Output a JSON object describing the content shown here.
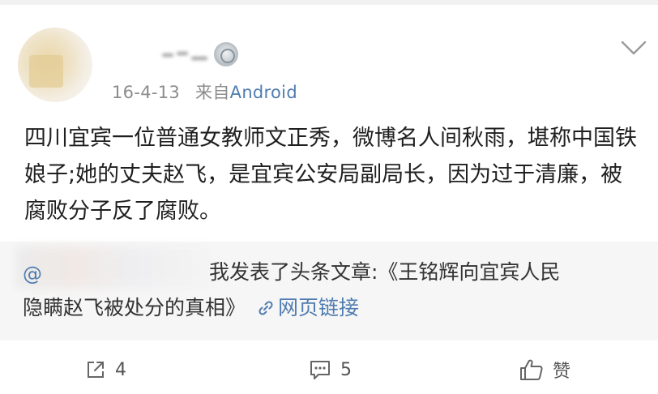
{
  "post": {
    "timestamp": "16-4-13",
    "source_prefix": "来自",
    "source": "Android",
    "body": "四川宜宾一位普通女教师文正秀，微博名人间秋雨，堪称中国铁娘子;她的丈夫赵飞，是宜宾公安局副局长，因为过于清廉，被腐败分子反了腐败。"
  },
  "repost": {
    "at_symbol": "@",
    "line1": "我发表了头条文章:《王铭辉向宜宾人民",
    "line2": "隐瞒赵飞被处分的真相》",
    "link_label": "网页链接"
  },
  "actions": {
    "share_count": "4",
    "comment_count": "5",
    "like_label": "赞"
  },
  "icons": {
    "share": "share-icon",
    "comment": "comment-icon",
    "like": "thumbs-up-icon",
    "link": "link-icon",
    "menu": "chevron-down-icon"
  },
  "colors": {
    "link": "#4f7cb1",
    "text": "#1f1f1f",
    "meta": "#8c8c8c",
    "repost_bg": "#f6f6f6"
  }
}
